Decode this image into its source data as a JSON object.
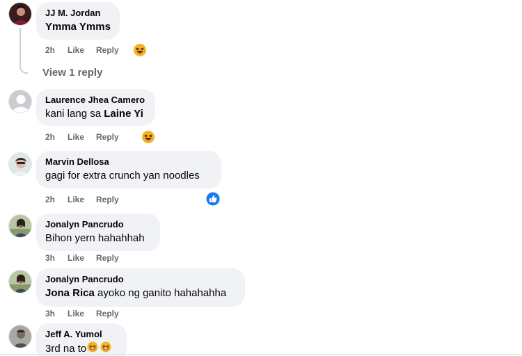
{
  "comments": [
    {
      "author": "JJ M. Jordan",
      "text_plain": "Ymma Ymms",
      "time": "2h",
      "like": "Like",
      "reply": "Reply",
      "reaction": "laugh-emoji-icon"
    },
    {
      "author": "Laurence Jhea Camero",
      "text_plain": "kani lang sa ",
      "text_tag": "Laine Yi",
      "time": "2h",
      "like": "Like",
      "reply": "Reply",
      "reaction": "laugh-emoji-icon"
    },
    {
      "author": "Marvin Dellosa",
      "text_plain": "gagi for extra crunch yan noodles",
      "time": "2h",
      "like": "Like",
      "reply": "Reply",
      "reaction": "like-reaction-icon"
    },
    {
      "author": "Jonalyn Pancrudo",
      "text_plain": "Bihon yern hahahhah",
      "time": "3h",
      "like": "Like",
      "reply": "Reply"
    },
    {
      "author": "Jonalyn Pancrudo",
      "text_tag": "Jona Rica",
      "text_plain": " ayoko ng ganito hahahahha",
      "time": "3h",
      "like": "Like",
      "reply": "Reply"
    },
    {
      "author": "Jeff A. Yumol",
      "text_plain": "3rd na to"
    }
  ],
  "view_reply": "View 1 reply",
  "colors": {
    "bubble": "#f0f2f5",
    "meta_text": "#65676b",
    "like_blue": "#1877f2",
    "emoji_yellow": "#f7b125"
  }
}
